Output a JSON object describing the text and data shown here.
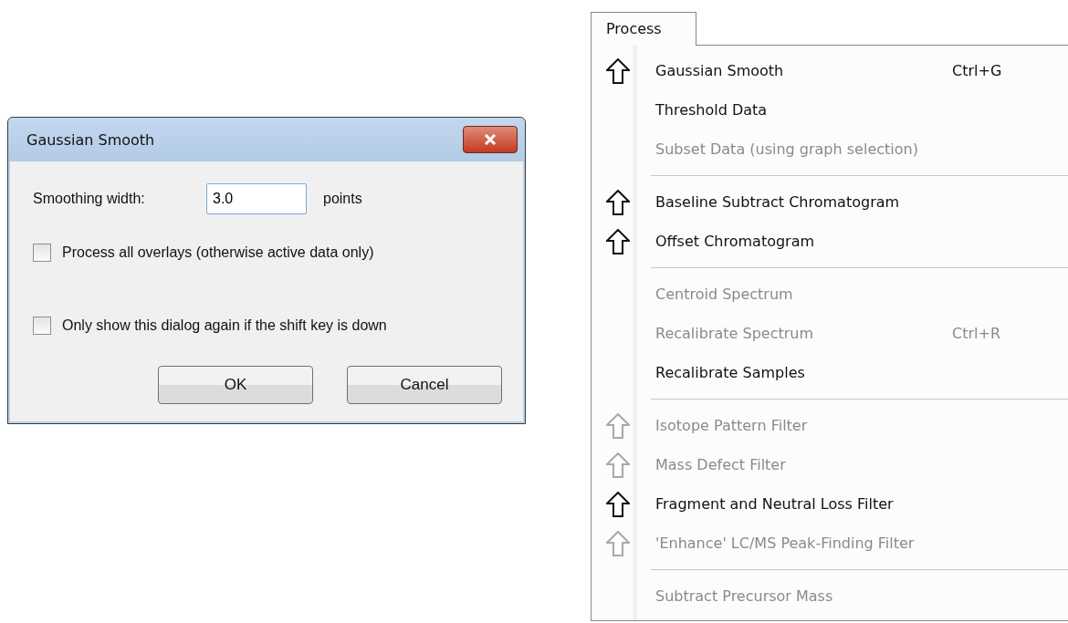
{
  "dialog": {
    "title": "Gaussian Smooth",
    "width_label": "Smoothing width:",
    "width_value": "3.0",
    "width_unit": "points",
    "options": [
      {
        "label": "Process all overlays (otherwise active data only)",
        "checked": false
      },
      {
        "label": "Only show this dialog again if the shift key is down",
        "checked": false
      }
    ],
    "buttons": [
      "OK",
      "Cancel"
    ]
  },
  "menu": {
    "title": "Process",
    "groups": [
      [
        {
          "label": "Gaussian Smooth",
          "shortcut": "Ctrl+G",
          "disabled": false,
          "shift_icon": true
        },
        {
          "label": "Threshold Data",
          "disabled": false,
          "shift_icon": false
        },
        {
          "label": "Subset Data (using graph selection)",
          "disabled": true,
          "shift_icon": false
        }
      ],
      [
        {
          "label": "Baseline Subtract Chromatogram",
          "disabled": false,
          "shift_icon": true
        },
        {
          "label": "Offset Chromatogram",
          "disabled": false,
          "shift_icon": true
        }
      ],
      [
        {
          "label": "Centroid Spectrum",
          "disabled": true,
          "shift_icon": false
        },
        {
          "label": "Recalibrate Spectrum",
          "shortcut": "Ctrl+R",
          "disabled": true,
          "shift_icon": false
        },
        {
          "label": "Recalibrate Samples",
          "disabled": false,
          "shift_icon": false
        }
      ],
      [
        {
          "label": "Isotope Pattern Filter",
          "disabled": true,
          "shift_icon": true
        },
        {
          "label": "Mass Defect Filter",
          "disabled": true,
          "shift_icon": true
        },
        {
          "label": "Fragment and Neutral Loss Filter",
          "disabled": false,
          "shift_icon": true
        },
        {
          "label": "'Enhance' LC/MS Peak-Finding Filter",
          "disabled": true,
          "shift_icon": true
        }
      ],
      [
        {
          "label": "Subtract Precursor Mass",
          "disabled": true,
          "shift_icon": false
        }
      ]
    ]
  }
}
